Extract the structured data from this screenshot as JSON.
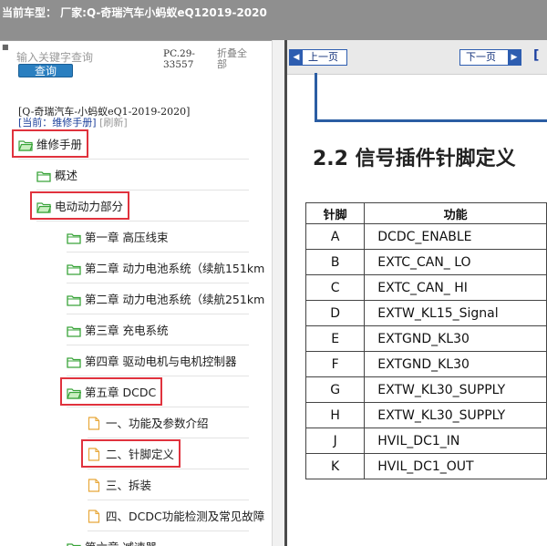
{
  "window": {
    "title": "当前车型：  厂家:Q-奇瑞汽车小蚂蚁eQ12019-2020"
  },
  "sidebar": {
    "search": {
      "placeholder": "输入关键字查询",
      "button_label": "查询"
    },
    "pc_code": "PC.29-33557",
    "collapse_all": "折叠全部",
    "tree_path": "[Q-奇瑞汽车-小蚂蚁eQ1-2019-2020]",
    "current_label": "[当前：维修手册]",
    "refresh_label": "[刷新]",
    "items": [
      {
        "label": "维修手册",
        "icon": "folder-open-icon",
        "level": 0,
        "highlighted": true
      },
      {
        "label": "概述",
        "icon": "folder-icon",
        "level": 1,
        "highlighted": false
      },
      {
        "label": "电动动力部分",
        "icon": "folder-open-icon",
        "level": 1,
        "highlighted": true
      },
      {
        "label": "第一章 高压线束",
        "icon": "folder-icon",
        "level": 2,
        "highlighted": false
      },
      {
        "label": "第二章 动力电池系统（续航151km",
        "icon": "folder-icon",
        "level": 2,
        "highlighted": false
      },
      {
        "label": "第二章 动力电池系统（续航251km",
        "icon": "folder-icon",
        "level": 2,
        "highlighted": false
      },
      {
        "label": "第三章 充电系统",
        "icon": "folder-icon",
        "level": 2,
        "highlighted": false
      },
      {
        "label": "第四章 驱动电机与电机控制器",
        "icon": "folder-icon",
        "level": 2,
        "highlighted": false
      },
      {
        "label": "第五章 DCDC",
        "icon": "folder-open-icon",
        "level": 2,
        "highlighted": true
      },
      {
        "label": "一、功能及参数介绍",
        "icon": "document-icon",
        "level": 3,
        "highlighted": false
      },
      {
        "label": "二、针脚定义",
        "icon": "document-icon",
        "level": 3,
        "highlighted": true
      },
      {
        "label": "三、拆装",
        "icon": "document-icon",
        "level": 3,
        "highlighted": false
      },
      {
        "label": "四、DCDC功能检测及常见故障",
        "icon": "document-icon",
        "level": 3,
        "highlighted": false
      },
      {
        "label": "第六章 减速器",
        "icon": "folder-icon",
        "level": 2,
        "highlighted": false
      }
    ]
  },
  "viewer": {
    "prev_label": "上一页",
    "next_label": "下一页",
    "extra_label": "[",
    "heading": "2.2 信号插件针脚定义",
    "table": {
      "headers": [
        "针脚",
        "功能"
      ],
      "rows": [
        [
          "A",
          "DCDC_ENABLE"
        ],
        [
          "B",
          "EXTC_CAN_ LO"
        ],
        [
          "C",
          "EXTC_CAN_ HI"
        ],
        [
          "D",
          "EXTW_KL15_Signal"
        ],
        [
          "E",
          "EXTGND_KL30"
        ],
        [
          "F",
          "EXTGND_KL30"
        ],
        [
          "G",
          "EXTW_KL30_SUPPLY"
        ],
        [
          "H",
          "EXTW_KL30_SUPPLY"
        ],
        [
          "J",
          "HVIL_DC1_IN"
        ],
        [
          "K",
          "HVIL_DC1_OUT"
        ]
      ]
    }
  },
  "colors": {
    "highlight": "#e0323d",
    "folder": "#3aa43a",
    "document": "#e8a83a",
    "button": "#2a7fc0",
    "titlebar": "#8f8f8f"
  }
}
